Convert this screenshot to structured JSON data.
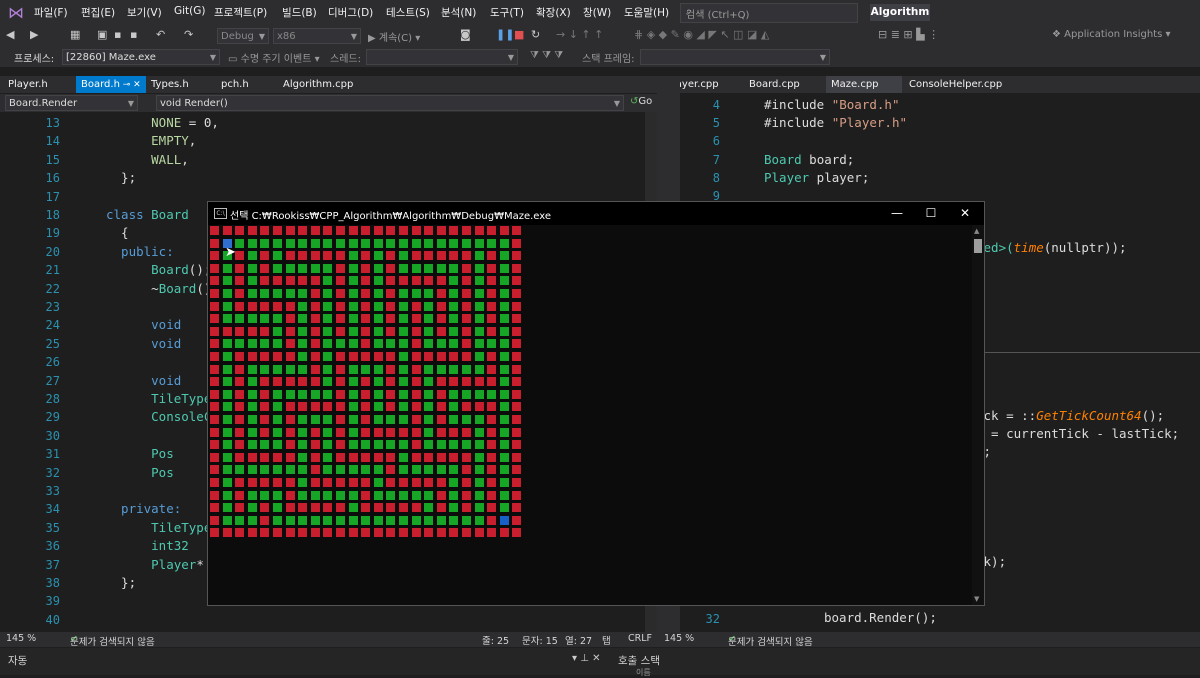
{
  "menu": {
    "items": [
      "파일(F)",
      "편집(E)",
      "보기(V)",
      "Git(G)",
      "프로젝트(P)",
      "빌드(B)",
      "디버그(D)",
      "테스트(S)",
      "분석(N)",
      "도구(T)",
      "확장(X)",
      "창(W)",
      "도움말(H)"
    ],
    "search_placeholder": "검색 (Ctrl+Q)",
    "solution_name": "Algorithm"
  },
  "toolbar": {
    "config": "Debug",
    "platform": "x86",
    "continue_label": "계속(C)",
    "app_insights": "Application Insights",
    "process_label": "프로세스:",
    "process_value": "[22860] Maze.exe",
    "lifecycle_label": "수명 주기 이벤트",
    "thread_label": "스레드:",
    "stackframe_label": "스택 프레임:"
  },
  "tabs_left": [
    {
      "label": "Player.h",
      "state": "normal"
    },
    {
      "label": "Board.h",
      "state": "active"
    },
    {
      "label": "Types.h",
      "state": "normal"
    },
    {
      "label": "pch.h",
      "state": "normal"
    },
    {
      "label": "Algorithm.cpp",
      "state": "normal"
    }
  ],
  "tabs_right": [
    {
      "label": "Player.cpp",
      "state": "normal"
    },
    {
      "label": "Board.cpp",
      "state": "normal"
    },
    {
      "label": "Maze.cpp",
      "state": "sel"
    },
    {
      "label": "ConsoleHelper.cpp",
      "state": "normal"
    }
  ],
  "nav": {
    "scope": "Board.Render",
    "member": "void Render()",
    "go_label": "Go"
  },
  "left_code": [
    {
      "n": "13",
      "t": [
        [
          "pl",
          "      "
        ],
        [
          "en",
          "NONE"
        ],
        [
          "pl",
          " = 0,"
        ]
      ]
    },
    {
      "n": "14",
      "t": [
        [
          "pl",
          "      "
        ],
        [
          "en",
          "EMPTY"
        ],
        [
          "pl",
          ","
        ]
      ]
    },
    {
      "n": "15",
      "t": [
        [
          "pl",
          "      "
        ],
        [
          "en",
          "WALL"
        ],
        [
          "pl",
          ","
        ]
      ]
    },
    {
      "n": "16",
      "t": [
        [
          "pl",
          "  };"
        ]
      ]
    },
    {
      "n": "17",
      "t": []
    },
    {
      "n": "18",
      "t": [
        [
          "kw",
          "class "
        ],
        [
          "ty",
          "Board"
        ]
      ]
    },
    {
      "n": "19",
      "t": [
        [
          "pl",
          "  {"
        ]
      ]
    },
    {
      "n": "20",
      "t": [
        [
          "kw",
          "  public:"
        ]
      ]
    },
    {
      "n": "21",
      "t": [
        [
          "pl",
          "      "
        ],
        [
          "ty",
          "Board"
        ],
        [
          "pl",
          "();"
        ]
      ]
    },
    {
      "n": "22",
      "t": [
        [
          "pl",
          "      ~"
        ],
        [
          "ty",
          "Board"
        ],
        [
          "pl",
          "();"
        ]
      ]
    },
    {
      "n": "23",
      "t": []
    },
    {
      "n": "24",
      "t": [
        [
          "pl",
          "      "
        ],
        [
          "kw",
          "void"
        ]
      ]
    },
    {
      "n": "25",
      "t": [
        [
          "pl",
          "      "
        ],
        [
          "kw",
          "void"
        ]
      ]
    },
    {
      "n": "26",
      "t": []
    },
    {
      "n": "27",
      "t": [
        [
          "pl",
          "      "
        ],
        [
          "kw",
          "void"
        ]
      ]
    },
    {
      "n": "28",
      "t": [
        [
          "pl",
          "      "
        ],
        [
          "ty",
          "TileType"
        ]
      ]
    },
    {
      "n": "29",
      "t": [
        [
          "pl",
          "      "
        ],
        [
          "ty",
          "ConsoleCo"
        ]
      ]
    },
    {
      "n": "30",
      "t": []
    },
    {
      "n": "31",
      "t": [
        [
          "pl",
          "      "
        ],
        [
          "ty",
          "Pos"
        ]
      ]
    },
    {
      "n": "32",
      "t": [
        [
          "pl",
          "      "
        ],
        [
          "ty",
          "Pos"
        ]
      ]
    },
    {
      "n": "33",
      "t": []
    },
    {
      "n": "34",
      "t": [
        [
          "kw",
          "  private:"
        ]
      ]
    },
    {
      "n": "35",
      "t": [
        [
          "pl",
          "      "
        ],
        [
          "ty",
          "TileType"
        ]
      ]
    },
    {
      "n": "36",
      "t": [
        [
          "pl",
          "      "
        ],
        [
          "ty",
          "int32"
        ]
      ]
    },
    {
      "n": "37",
      "t": [
        [
          "pl",
          "      "
        ],
        [
          "ty",
          "Player"
        ],
        [
          "pl",
          "*"
        ]
      ]
    },
    {
      "n": "38",
      "t": [
        [
          "pl",
          "  };"
        ]
      ]
    },
    {
      "n": "39",
      "t": []
    },
    {
      "n": "40",
      "t": []
    }
  ],
  "right_code": [
    {
      "n": "4",
      "t": [
        [
          "pl",
          "#include "
        ],
        [
          "str",
          "\"Board.h\""
        ]
      ]
    },
    {
      "n": "5",
      "t": [
        [
          "pl",
          "#include "
        ],
        [
          "str",
          "\"Player.h\""
        ]
      ]
    },
    {
      "n": "6",
      "t": []
    },
    {
      "n": "7",
      "t": [
        [
          "ty",
          "Board"
        ],
        [
          "pl",
          " board;"
        ]
      ]
    },
    {
      "n": "8",
      "t": [
        [
          "ty",
          "Player"
        ],
        [
          "pl",
          " player;"
        ]
      ]
    },
    {
      "n": "9",
      "t": []
    }
  ],
  "right_fragments": {
    "f1a": "ned>(",
    "f1b": "time",
    "f1c": "(nullptr));",
    "f2a": "ick = ::",
    "f2b": "GetTickCount64",
    "f2c": "();",
    "f3": "k = currentTick - lastTick;",
    "f4": "k;",
    "f5": "ck);",
    "ln32": "32",
    "f6": "board.Render();"
  },
  "status_left": {
    "zoom": "145 %",
    "issues": "문제가 검색되지 않음",
    "line": "줄: 25",
    "char": "문자: 15",
    "col": "열: 27",
    "tab": "탭",
    "eol": "CRLF"
  },
  "status_right": {
    "zoom": "145 %",
    "issues": "문제가 검색되지 않음"
  },
  "panels": {
    "auto": "자동",
    "callstack": "호출 스택",
    "name_col": "이름"
  },
  "console": {
    "title": "선택 C:₩Rookiss₩CPP_Algorithm₩Algorithm₩Debug₩Maze.exe",
    "minimize": "—",
    "maximize": "☐",
    "close": "✕"
  },
  "maze": {
    "size": 25,
    "colors": {
      "wall": "#c81e2e",
      "empty": "#16a524",
      "player": "#2f6fd0",
      "exit": "#1660c8"
    },
    "player": [
      1,
      1
    ],
    "exit": [
      23,
      23
    ],
    "rows": [
      "#########################",
      "#.......................#",
      "#.#.#.#####.#.#.#####.#.#",
      "#.#.#.....#.#.#.....#.#.#",
      "#.#.#####.#.#.#####.#.#.#",
      "#.#.....#.#.#.#...#.#.#.#",
      "#.#####.#.#.#.#.#.#.#.#.#",
      "#.....#.#.#.#.#.#.#.#.#.#",
      "#####.#.#.#.#.#.#.#.#.#.#",
      "#.....#.#...#...#...#...#",
      "#.#####.#.#####.#####.#.#",
      "#.#.....#.#...#.#.....#.#",
      "#.#.#####.#.#.#.#.#####.#",
      "#.#.#.....#.#.#.#.#.....#",
      "#.#.#.#####.#.#.#.#.###.#",
      "#.#.#.#...#.#...#.#...#.#",
      "#.#.#.#.#.#.#####.###.#.#",
      "#.#...#.#.#.....#.....#.#",
      "#.#####.#.#####.#####.#.#",
      "#.......#.....#.....#.#.#",
      "#.#####.#####.#####.#.#.#",
      "#.#...#.....#.....#.#.#.#",
      "#.#.#.#####.#####.#.#.#.#",
      "#...#.................#.#",
      "#########################"
    ]
  }
}
